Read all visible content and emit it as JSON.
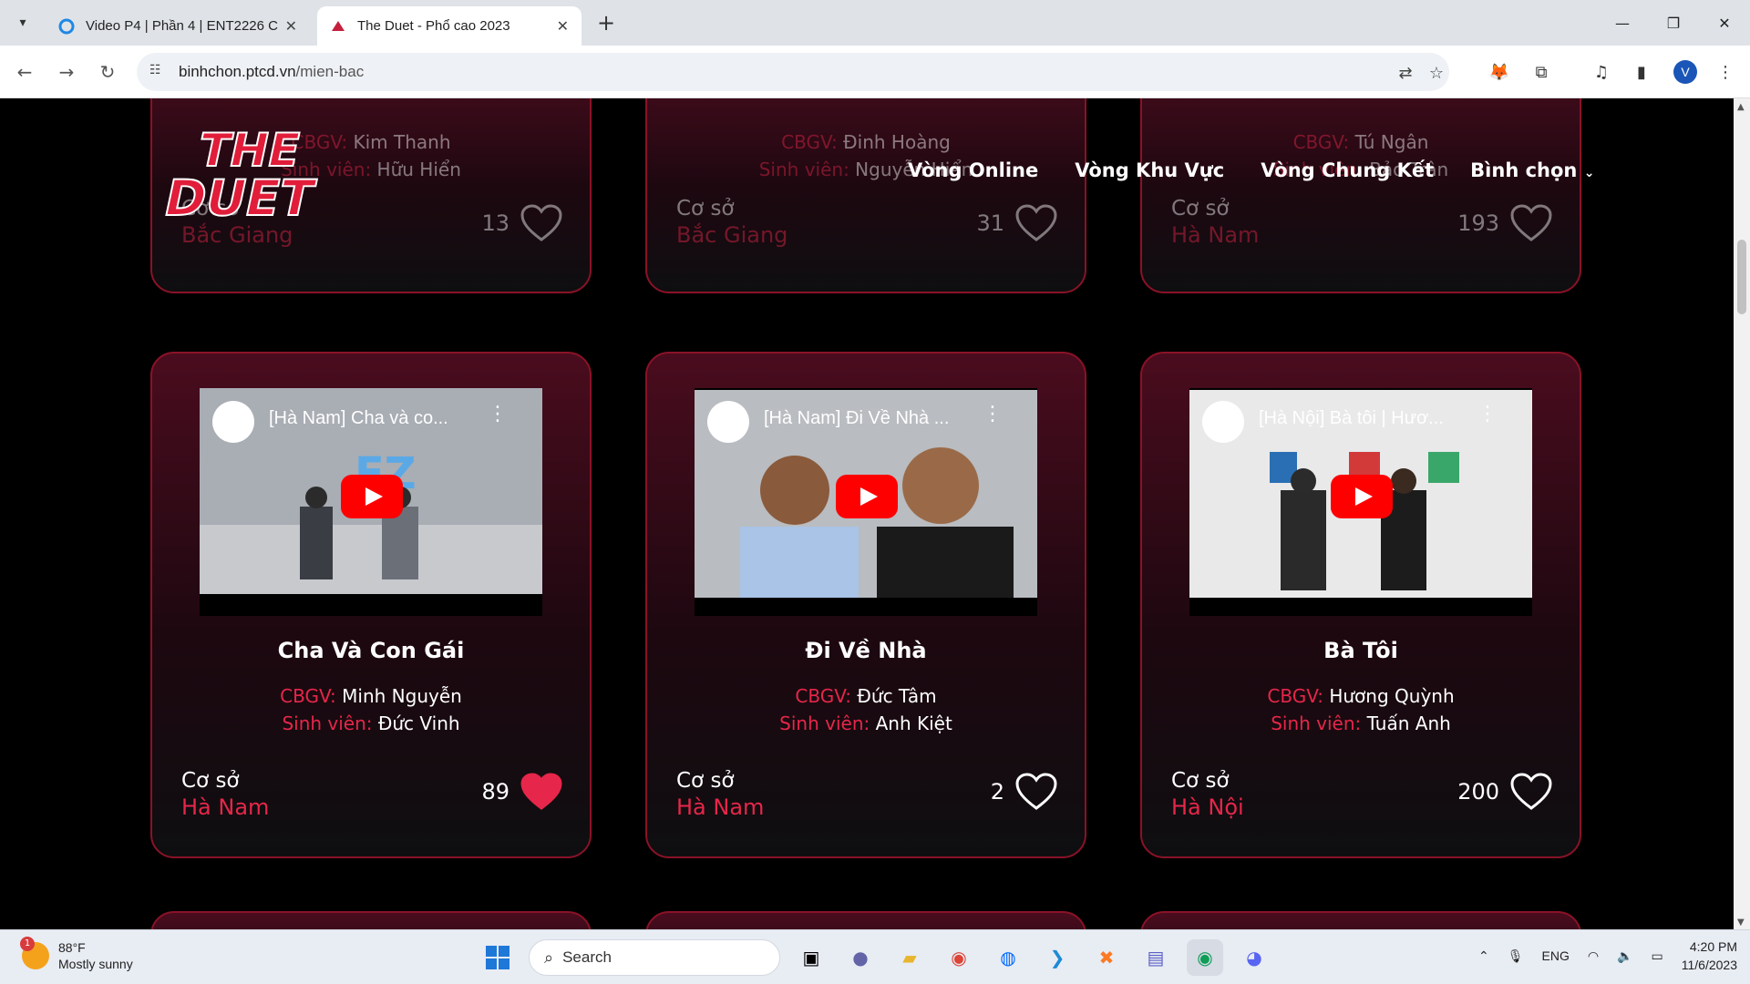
{
  "browser": {
    "tabs": [
      {
        "title": "Video P4 | Phần 4 | ENT2226 C",
        "active": false
      },
      {
        "title": "The Duet - Phổ cao 2023",
        "active": true
      }
    ],
    "url_host": "binhchon.ptcd.vn",
    "url_path": "/mien-bac",
    "profile_initial": "V"
  },
  "site": {
    "logo_text_1": "THE",
    "logo_text_2": "DUET",
    "nav": [
      "Vòng Online",
      "Vòng Khu Vực",
      "Vòng Chung Kết",
      "Bình chọn"
    ],
    "accent": "#e6264a"
  },
  "labels": {
    "teacher": "CBGV:",
    "student": "Sinh viên:",
    "base": "Cơ sở"
  },
  "top_cards": [
    {
      "teacher": "Kim Thanh",
      "student": "Hữu Hiển",
      "base": "Bắc Giang",
      "votes": "13",
      "liked": false
    },
    {
      "teacher": "Đinh Hoàng",
      "student": "Nguyễn Hiển",
      "base": "Bắc Giang",
      "votes": "31",
      "liked": false
    },
    {
      "teacher": "Tú Ngân",
      "student": "Bảo Trân",
      "base": "Hà Nam",
      "votes": "193",
      "liked": false
    }
  ],
  "cards": [
    {
      "video_title": "[Hà Nam] Cha và co...",
      "title": "Cha Và Con Gái",
      "teacher": "Minh Nguyễn",
      "student": "Đức Vinh",
      "base": "Hà Nam",
      "votes": "89",
      "liked": true
    },
    {
      "video_title": "[Hà Nam] Đi Về Nhà ...",
      "title": "Đi Về Nhà",
      "teacher": "Đức Tâm",
      "student": "Anh Kiệt",
      "base": "Hà Nam",
      "votes": "2",
      "liked": false
    },
    {
      "video_title": "[Hà Nội] Bà tôi | Hươ...",
      "title": "Bà Tôi",
      "teacher": "Hương Quỳnh",
      "student": "Tuấn Anh",
      "base": "Hà Nội",
      "votes": "200",
      "liked": false
    }
  ],
  "taskbar": {
    "weather_temp": "88°F",
    "weather_desc": "Mostly sunny",
    "weather_badge": "1",
    "search_label": "Search",
    "language": "ENG",
    "time": "4:20 PM",
    "date": "11/6/2023"
  }
}
